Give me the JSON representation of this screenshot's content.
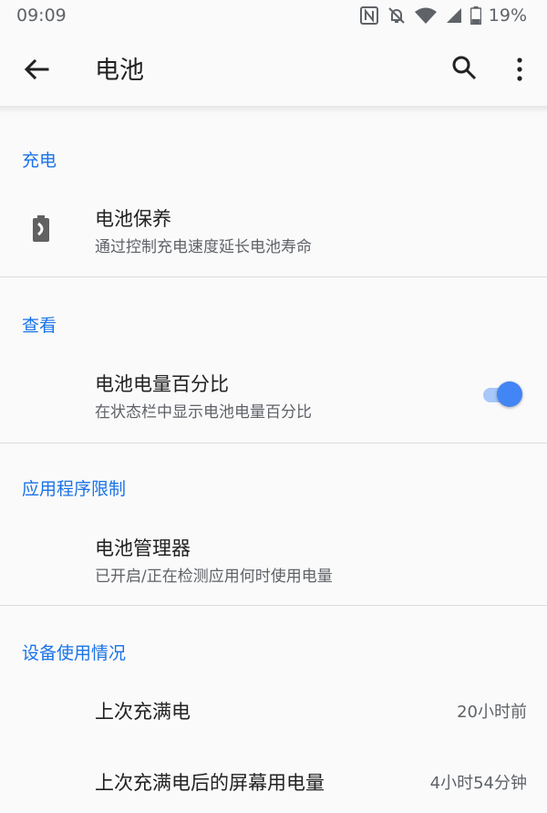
{
  "status": {
    "time": "09:09",
    "battery_percent": "19%",
    "icons": [
      "nfc-icon",
      "bell-off-icon",
      "wifi-icon",
      "signal-icon",
      "battery-icon"
    ]
  },
  "appbar": {
    "title": "电池",
    "icons": [
      "back-arrow-icon",
      "search-icon",
      "more-vert-icon"
    ]
  },
  "sections": {
    "charging": {
      "header": "充电",
      "item": {
        "title": "电池保养",
        "subtitle": "通过控制充电速度延长电池寿命",
        "icon": "battery-care-icon"
      }
    },
    "view": {
      "header": "查看",
      "item": {
        "title": "电池电量百分比",
        "subtitle": "在状态栏中显示电池电量百分比",
        "toggle_on": true
      }
    },
    "app_restrictions": {
      "header": "应用程序限制",
      "item": {
        "title": "电池管理器",
        "subtitle": "已开启/正在检测应用何时使用电量"
      }
    },
    "usage": {
      "header": "设备使用情况",
      "items": [
        {
          "title": "上次充满电",
          "value": "20小时前"
        },
        {
          "title": "上次充满电后的屏幕用电量",
          "value": "4小时54分钟"
        }
      ]
    }
  },
  "colors": {
    "accent": "#1a73e8",
    "toggle_thumb": "#4285f4",
    "toggle_track": "#a8c7fa"
  }
}
